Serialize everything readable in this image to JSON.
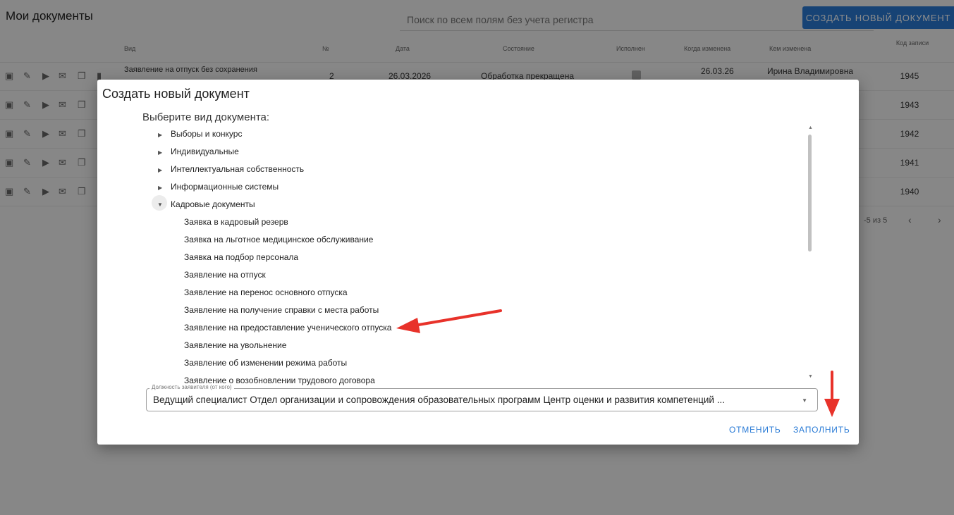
{
  "header": {
    "title": "Мои документы",
    "search_placeholder": "Поиск по всем полям без учета регистра",
    "create_button": "СОЗДАТЬ НОВЫЙ ДОКУМЕНТ"
  },
  "table": {
    "columns": {
      "type": "Вид",
      "number": "№",
      "date": "Дата",
      "state": "Состояние",
      "done": "Исполнен",
      "changed_when": "Когда изменена",
      "changed_by": "Кем изменена",
      "code": "Код записи"
    },
    "rows": [
      {
        "type": "Заявление на отпуск без сохранения",
        "number": "2",
        "date": "26.03.2026",
        "state": "Обработка прекращена",
        "changed_when": "26.03.26",
        "changed_by": "Ирина Владимировна",
        "code": "1945"
      },
      {
        "code": "1943"
      },
      {
        "code": "1942"
      },
      {
        "code": "1941"
      },
      {
        "code": "1940"
      }
    ],
    "pagination": "-5 из 5"
  },
  "dialog": {
    "title": "Создать новый документ",
    "subtitle": "Выберите вид документа:",
    "categories": [
      {
        "label": "Выборы и конкурс",
        "expanded": false
      },
      {
        "label": "Индивидуальные",
        "expanded": false
      },
      {
        "label": "Интеллектуальная собственность",
        "expanded": false
      },
      {
        "label": "Информационные системы",
        "expanded": false
      },
      {
        "label": "Кадровые документы",
        "expanded": true
      }
    ],
    "children": [
      "Заявка в кадровый резерв",
      "Заявка на льготное медицинское обслуживание",
      "Заявка на подбор персонала",
      "Заявление на отпуск",
      "Заявление на перенос основного отпуска",
      "Заявление на получение справки с места работы",
      "Заявление на предоставление ученического отпуска",
      "Заявление на увольнение",
      "Заявление об изменении режима работы",
      "Заявление о возобновлении трудового договора"
    ],
    "position_field": {
      "label": "Должность заявителя (от кого)",
      "value": "Ведущий специалист Отдел организации и сопровождения образовательных программ Центр оценки и развития компетенций ..."
    },
    "cancel_button": "ОТМЕНИТЬ",
    "fill_button": "ЗАПОЛНИТЬ"
  },
  "colors": {
    "accent": "#2a7bd6",
    "annotation_arrow": "#e8322a"
  }
}
